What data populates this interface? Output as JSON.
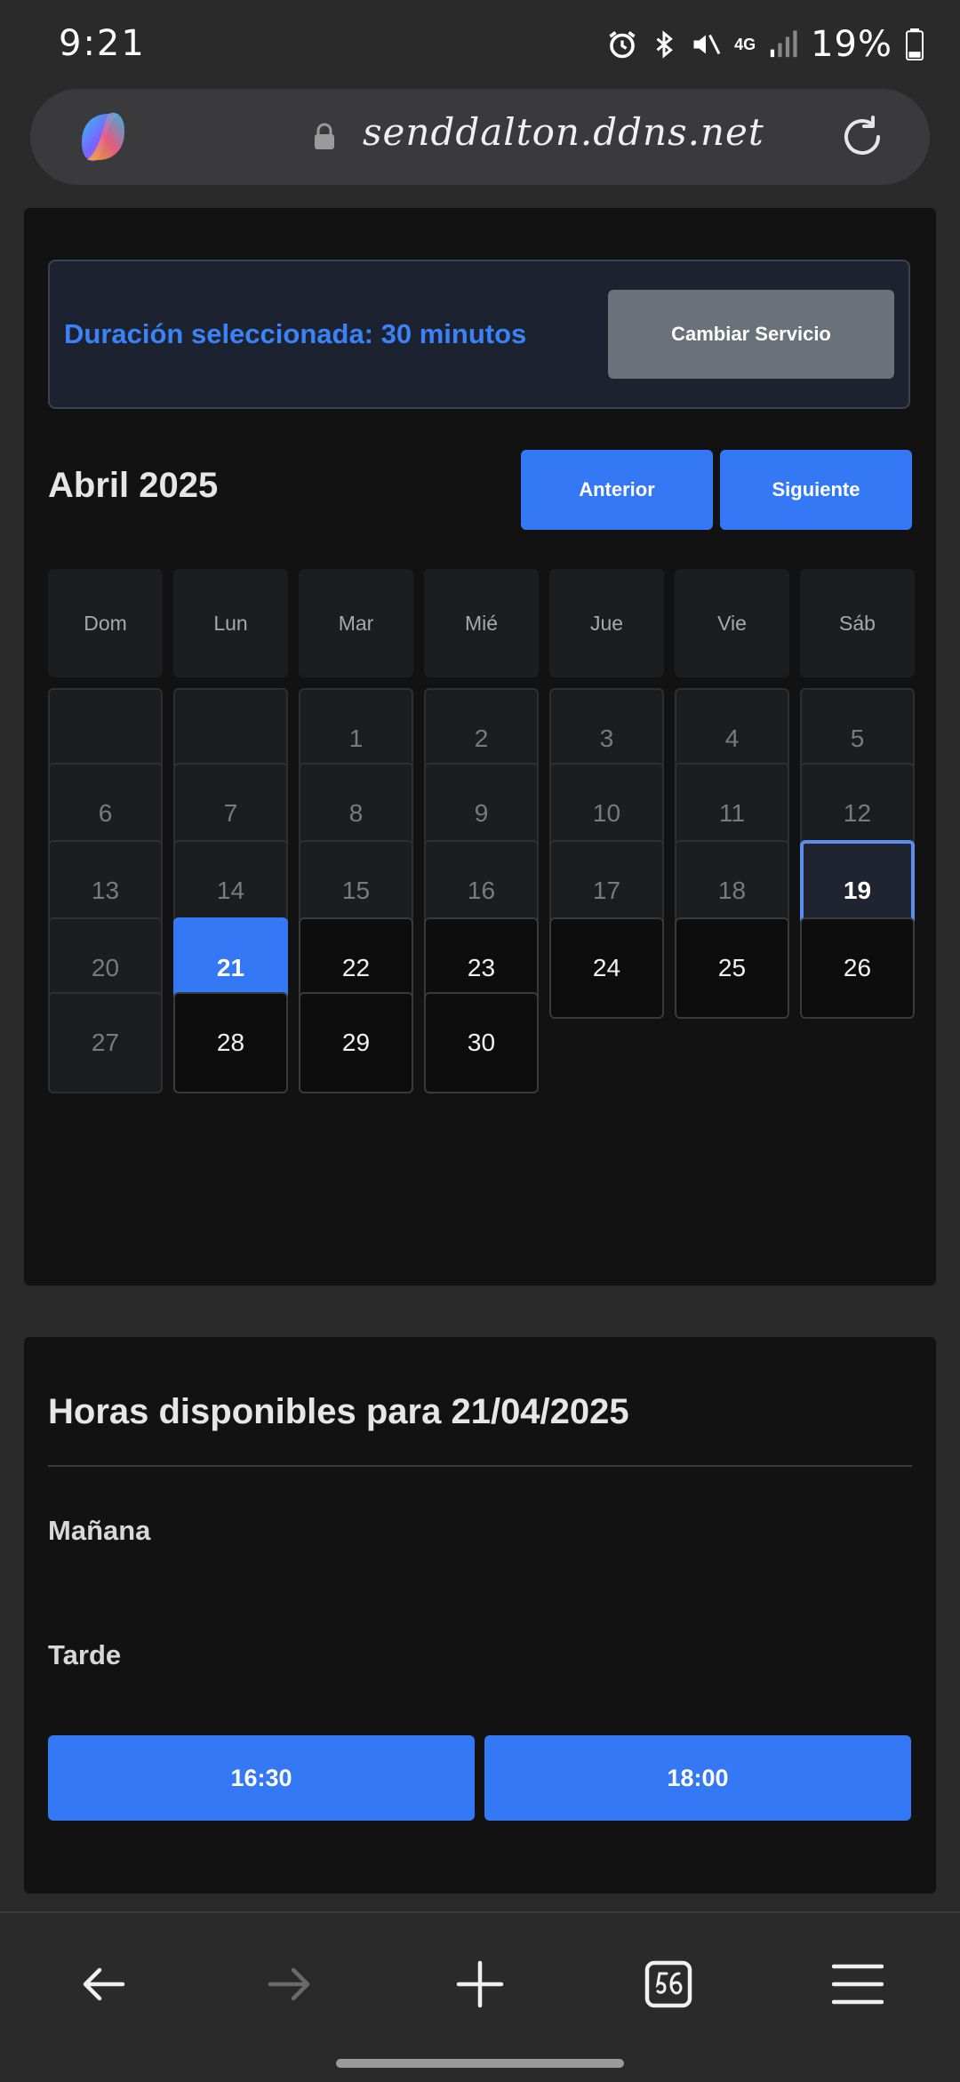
{
  "status_bar": {
    "time": "9:21",
    "battery": "19%",
    "network": "4G"
  },
  "browser": {
    "url": "senddalton.ddns.net",
    "icons": [
      "copilot-logo",
      "lock-icon",
      "reload-icon"
    ]
  },
  "booking": {
    "duration_label": "Duración seleccionada: 30 minutos",
    "change_service_label": "Cambiar Servicio",
    "month_title": "Abril 2025",
    "prev_label": "Anterior",
    "next_label": "Siguiente",
    "weekdays": [
      "Dom",
      "Lun",
      "Mar",
      "Mié",
      "Jue",
      "Vie",
      "Sáb"
    ],
    "weeks": [
      [
        {
          "d": "",
          "s": "empty"
        },
        {
          "d": "",
          "s": "empty"
        },
        {
          "d": "1",
          "s": "past"
        },
        {
          "d": "2",
          "s": "past"
        },
        {
          "d": "3",
          "s": "past"
        },
        {
          "d": "4",
          "s": "past"
        },
        {
          "d": "5",
          "s": "past"
        }
      ],
      [
        {
          "d": "6",
          "s": "past"
        },
        {
          "d": "7",
          "s": "past"
        },
        {
          "d": "8",
          "s": "past"
        },
        {
          "d": "9",
          "s": "past"
        },
        {
          "d": "10",
          "s": "past"
        },
        {
          "d": "11",
          "s": "past"
        },
        {
          "d": "12",
          "s": "past"
        }
      ],
      [
        {
          "d": "13",
          "s": "past"
        },
        {
          "d": "14",
          "s": "past"
        },
        {
          "d": "15",
          "s": "past"
        },
        {
          "d": "16",
          "s": "past"
        },
        {
          "d": "17",
          "s": "past"
        },
        {
          "d": "18",
          "s": "past"
        },
        {
          "d": "19",
          "s": "today"
        }
      ],
      [
        {
          "d": "20",
          "s": "past"
        },
        {
          "d": "21",
          "s": "selected"
        },
        {
          "d": "22",
          "s": "avail"
        },
        {
          "d": "23",
          "s": "avail"
        },
        {
          "d": "24",
          "s": "avail"
        },
        {
          "d": "25",
          "s": "avail"
        },
        {
          "d": "26",
          "s": "avail"
        }
      ],
      [
        {
          "d": "27",
          "s": "past"
        },
        {
          "d": "28",
          "s": "avail"
        },
        {
          "d": "29",
          "s": "avail"
        },
        {
          "d": "30",
          "s": "avail"
        }
      ]
    ]
  },
  "hours": {
    "title": "Horas disponibles para 21/04/2025",
    "morning_label": "Mañana",
    "afternoon_label": "Tarde",
    "afternoon_slots": [
      "16:30",
      "18:00"
    ]
  },
  "colors": {
    "accent": "#3478f6",
    "background": "#121212",
    "today_border": "#5b8def"
  }
}
